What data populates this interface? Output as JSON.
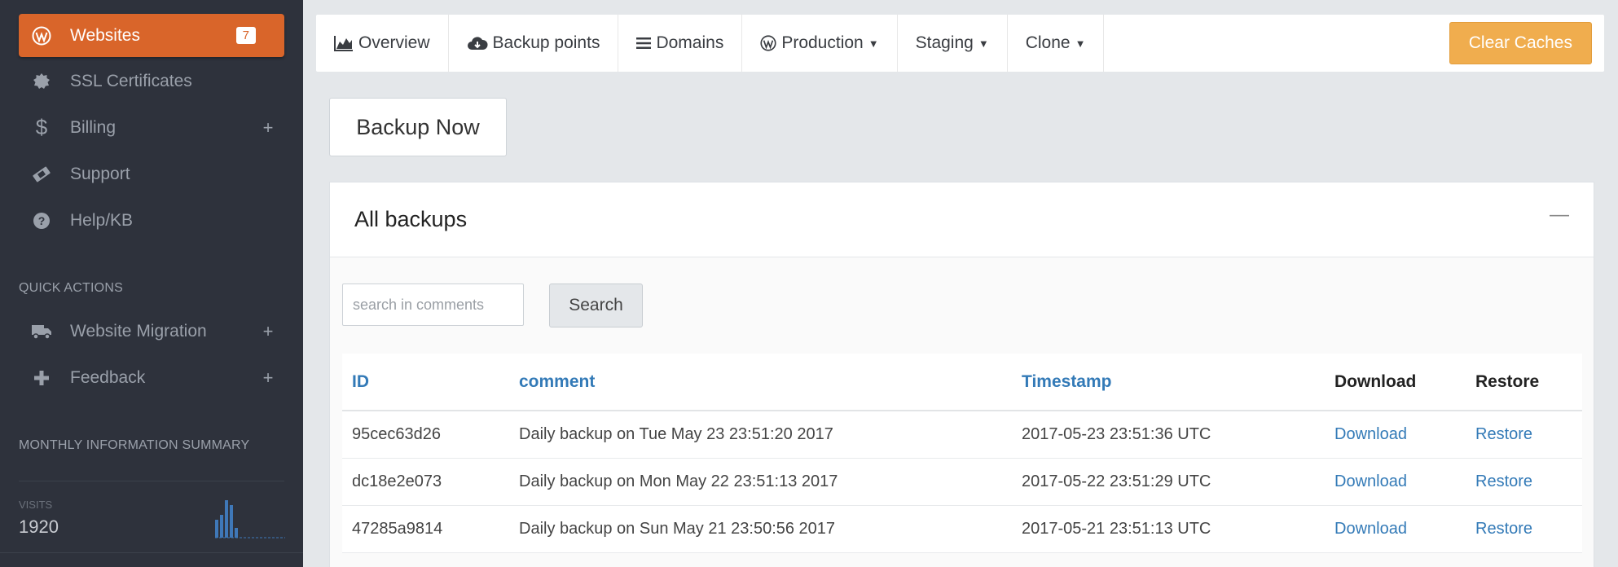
{
  "sidebar": {
    "items": [
      {
        "label": "Websites",
        "badge": "7",
        "icon": "wordpress-icon",
        "active": true
      },
      {
        "label": "SSL Certificates",
        "icon": "certificate-icon"
      },
      {
        "label": "Billing",
        "icon": "dollar-icon",
        "expand": "+"
      },
      {
        "label": "Support",
        "icon": "ticket-icon"
      },
      {
        "label": "Help/KB",
        "icon": "question-circle-icon"
      }
    ],
    "quick_actions_title": "QUICK ACTIONS",
    "quick_actions": [
      {
        "label": "Website Migration",
        "icon": "truck-icon",
        "expand": "+"
      },
      {
        "label": "Feedback",
        "icon": "plus-icon",
        "expand": "+"
      }
    ],
    "monthly_title": "MONTHLY INFORMATION SUMMARY",
    "visits_label": "VISITS",
    "visits_value": "1920",
    "sparkline": [
      22,
      28,
      46,
      40,
      12,
      0,
      0,
      0,
      0,
      0,
      0,
      0,
      0
    ]
  },
  "tabs": [
    {
      "label": "Overview",
      "icon": "area-chart-icon"
    },
    {
      "label": "Backup points",
      "icon": "cloud-download-icon"
    },
    {
      "label": "Domains",
      "icon": "bars-icon"
    },
    {
      "label": "Production",
      "icon": "wordpress-icon",
      "dropdown": true
    },
    {
      "label": "Staging",
      "dropdown": true
    },
    {
      "label": "Clone",
      "dropdown": true
    }
  ],
  "clear_caches_label": "Clear Caches",
  "backup_now_label": "Backup Now",
  "panel": {
    "title": "All backups",
    "collapse_symbol": "—",
    "search_placeholder": "search in comments",
    "search_button": "Search",
    "columns": [
      "ID",
      "comment",
      "Timestamp",
      "Download",
      "Restore"
    ],
    "rows": [
      {
        "id": "95cec63d26",
        "comment": "Daily backup on Tue May 23 23:51:20 2017",
        "timestamp": "2017-05-23 23:51:36 UTC",
        "download": "Download",
        "restore": "Restore"
      },
      {
        "id": "dc18e2e073",
        "comment": "Daily backup on Mon May 22 23:51:13 2017",
        "timestamp": "2017-05-22 23:51:29 UTC",
        "download": "Download",
        "restore": "Restore"
      },
      {
        "id": "47285a9814",
        "comment": "Daily backup on Sun May 21 23:50:56 2017",
        "timestamp": "2017-05-21 23:51:13 UTC",
        "download": "Download",
        "restore": "Restore"
      }
    ]
  },
  "colors": {
    "accent": "#d9652a",
    "link": "#337ab7",
    "warning": "#f0ad4e",
    "sidebar_bg": "#2e323c"
  }
}
